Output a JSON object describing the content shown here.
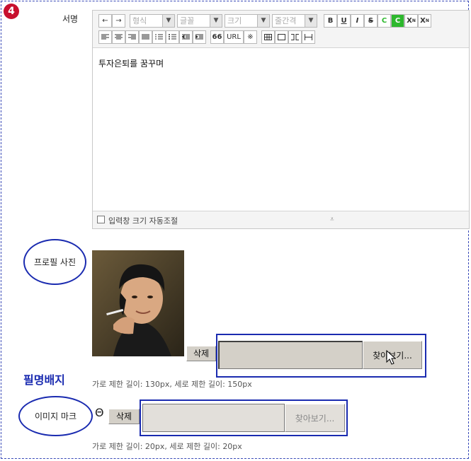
{
  "step_number": "4",
  "signature": {
    "label": "서명",
    "toolbar": {
      "undo": "←",
      "redo": "→",
      "format_select": "형식",
      "font_select": "글꼴",
      "size_select": "크기",
      "line_height_select": "줄간격",
      "bold": "B",
      "underline": "U",
      "italic": "I",
      "strike": "S",
      "text_color": "C",
      "bg_color": "C",
      "superscript": "X",
      "subscript": "X",
      "quote": "66",
      "url": "URL",
      "special_char": "※"
    },
    "content": "투자은퇴를 꿈꾸며",
    "auto_resize_label": "입력창 크기 자동조절"
  },
  "profile_photo": {
    "label": "프로필 사진",
    "delete_button": "삭제",
    "browse_button": "찾아보기...",
    "hint": "가로 제한 길이: 130px, 세로 제한 길이: 150px"
  },
  "name_badge": {
    "title": "필명배지"
  },
  "image_mark": {
    "label": "이미지 마크",
    "symbol": "Θ",
    "delete_button": "삭제",
    "browse_button": "찾아보기...",
    "hint": "가로 제한 길이: 20px, 세로 제한 길이: 20px"
  },
  "colors": {
    "accent": "#1a2bb0",
    "badge": "#c8102e",
    "green_button": "#2db82d"
  }
}
